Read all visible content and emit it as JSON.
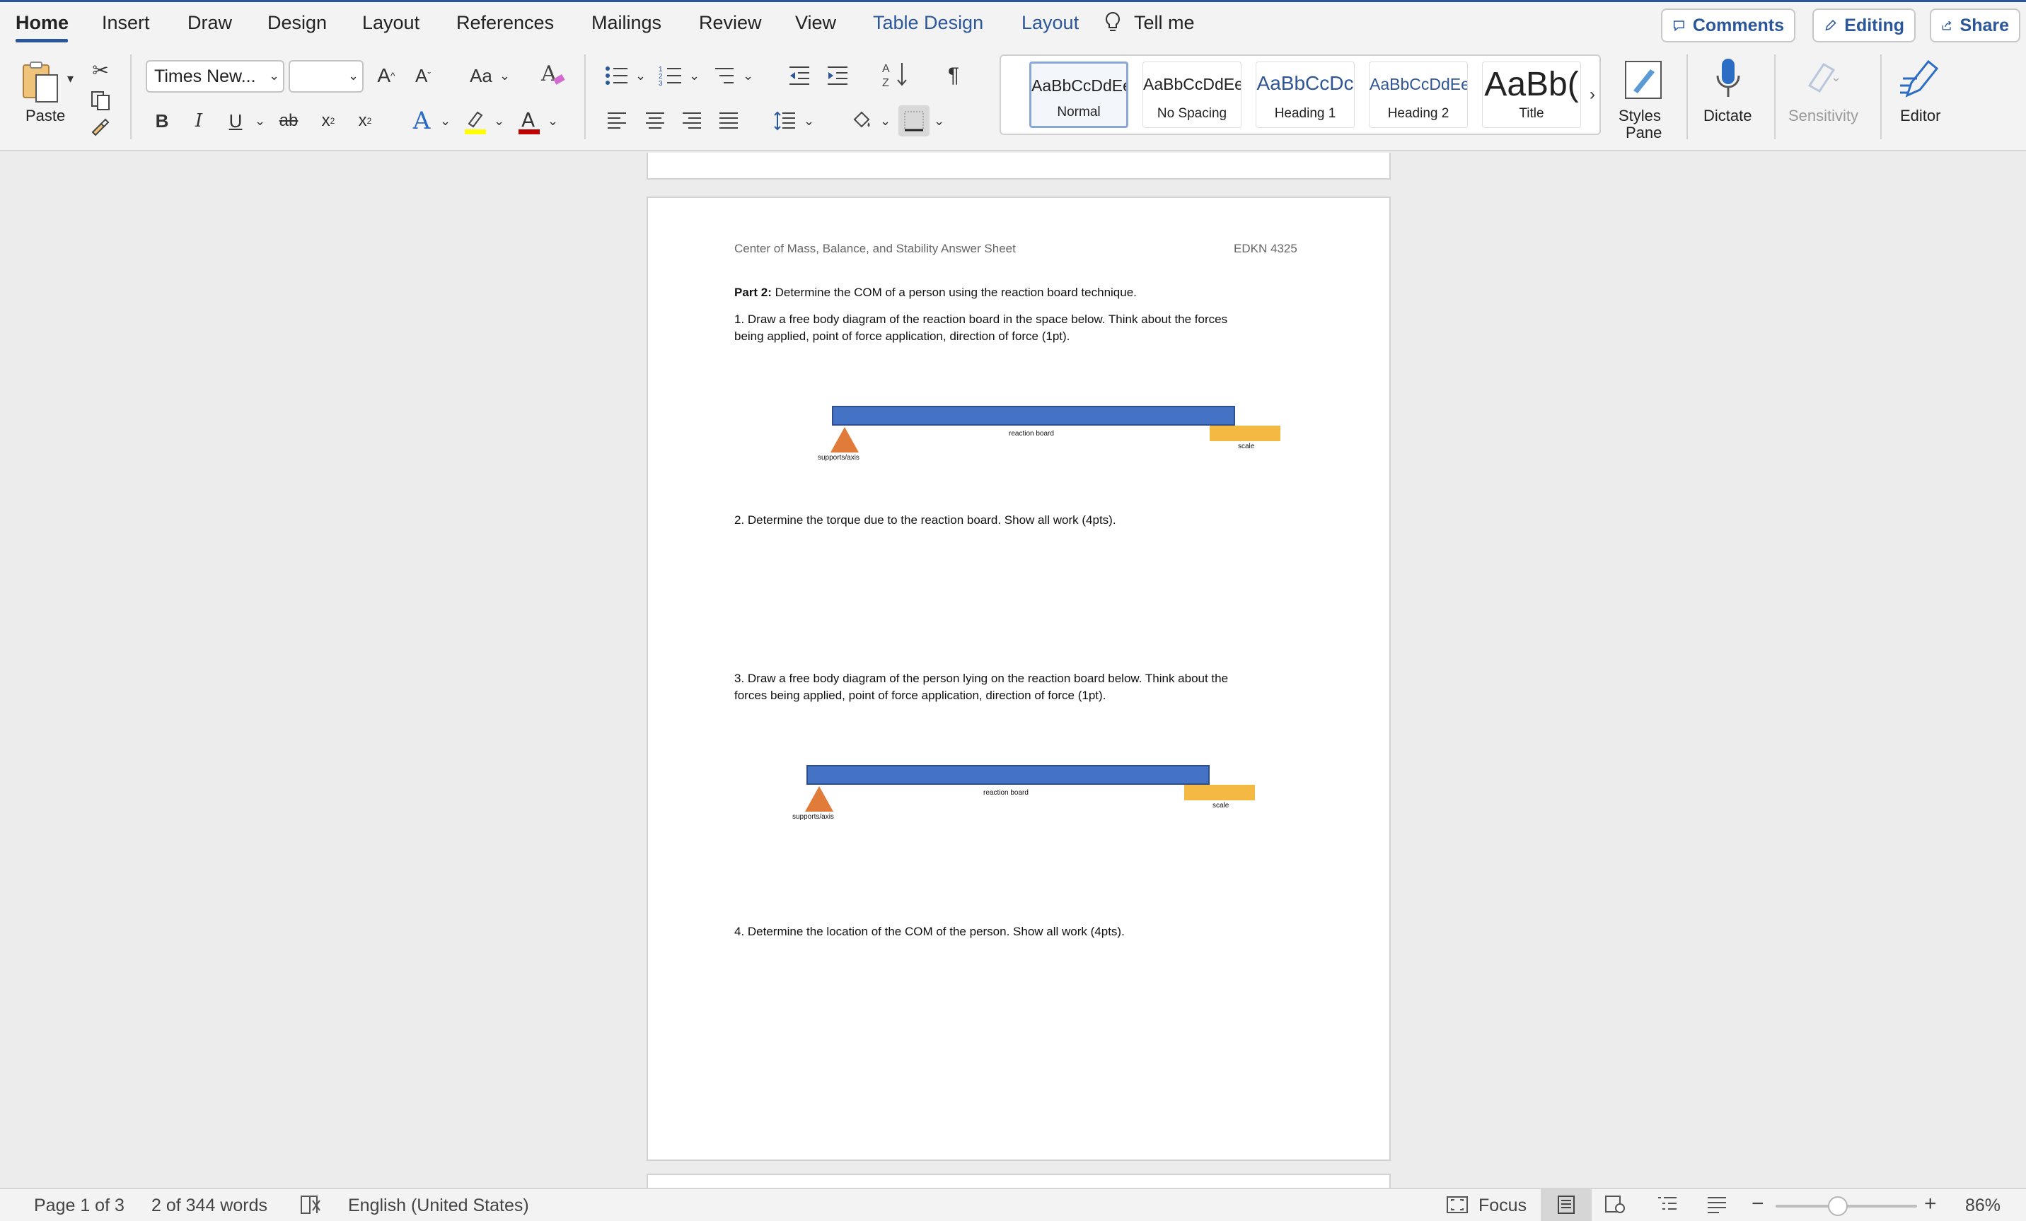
{
  "ribbon": {
    "tabs": [
      "Home",
      "Insert",
      "Draw",
      "Design",
      "Layout",
      "References",
      "Mailings",
      "Review",
      "View",
      "Table Design",
      "Layout"
    ],
    "tell_me": "Tell me",
    "comments": "Comments",
    "editing": "Editing",
    "share": "Share",
    "paste_label": "Paste",
    "font_name": "Times New...",
    "font_size": "",
    "styles": [
      {
        "sample": "AaBbCcDdEe",
        "name": "Normal"
      },
      {
        "sample": "AaBbCcDdEe",
        "name": "No Spacing"
      },
      {
        "sample": "AaBbCcDc",
        "name": "Heading 1"
      },
      {
        "sample": "AaBbCcDdEe",
        "name": "Heading 2"
      },
      {
        "sample": "AaBb(",
        "name": "Title"
      }
    ],
    "styles_pane_line1": "Styles",
    "styles_pane_line2": "Pane",
    "dictate": "Dictate",
    "sensitivity": "Sensitivity",
    "editor": "Editor",
    "colors": {
      "accent": "#2b579a",
      "highlight": "#ffff00",
      "font_color": "#c00000"
    }
  },
  "document": {
    "header_left": "Center of Mass, Balance, and Stability Answer Sheet",
    "header_right": "EDKN 4325",
    "part_bold": "Part 2:",
    "part_text": " Determine the COM of a person using the reaction board technique.",
    "q1_line1": "1. Draw a free body diagram of the reaction board in the space below. Think about the forces",
    "q1_line2": "being applied, point of force application, direction of force (1pt).",
    "q2": "2. Determine the torque due to the reaction board. Show all work (4pts).",
    "q3_line1": "3. Draw a free body diagram of the person lying on the reaction board below. Think about the",
    "q3_line2": "forces being applied, point of force application, direction of force (1pt).",
    "q4": "4. Determine the location of the COM of the person. Show all work (4pts).",
    "diagram_labels": {
      "board": "reaction board",
      "scale": "scale",
      "support": "supports/axis"
    },
    "colors": {
      "board": "#4472c4",
      "scale": "#f4b942",
      "support": "#e07b39"
    }
  },
  "status": {
    "page": "Page 1 of 3",
    "words": "2 of 344 words",
    "language": "English (United States)",
    "focus": "Focus",
    "zoom": "86%"
  }
}
